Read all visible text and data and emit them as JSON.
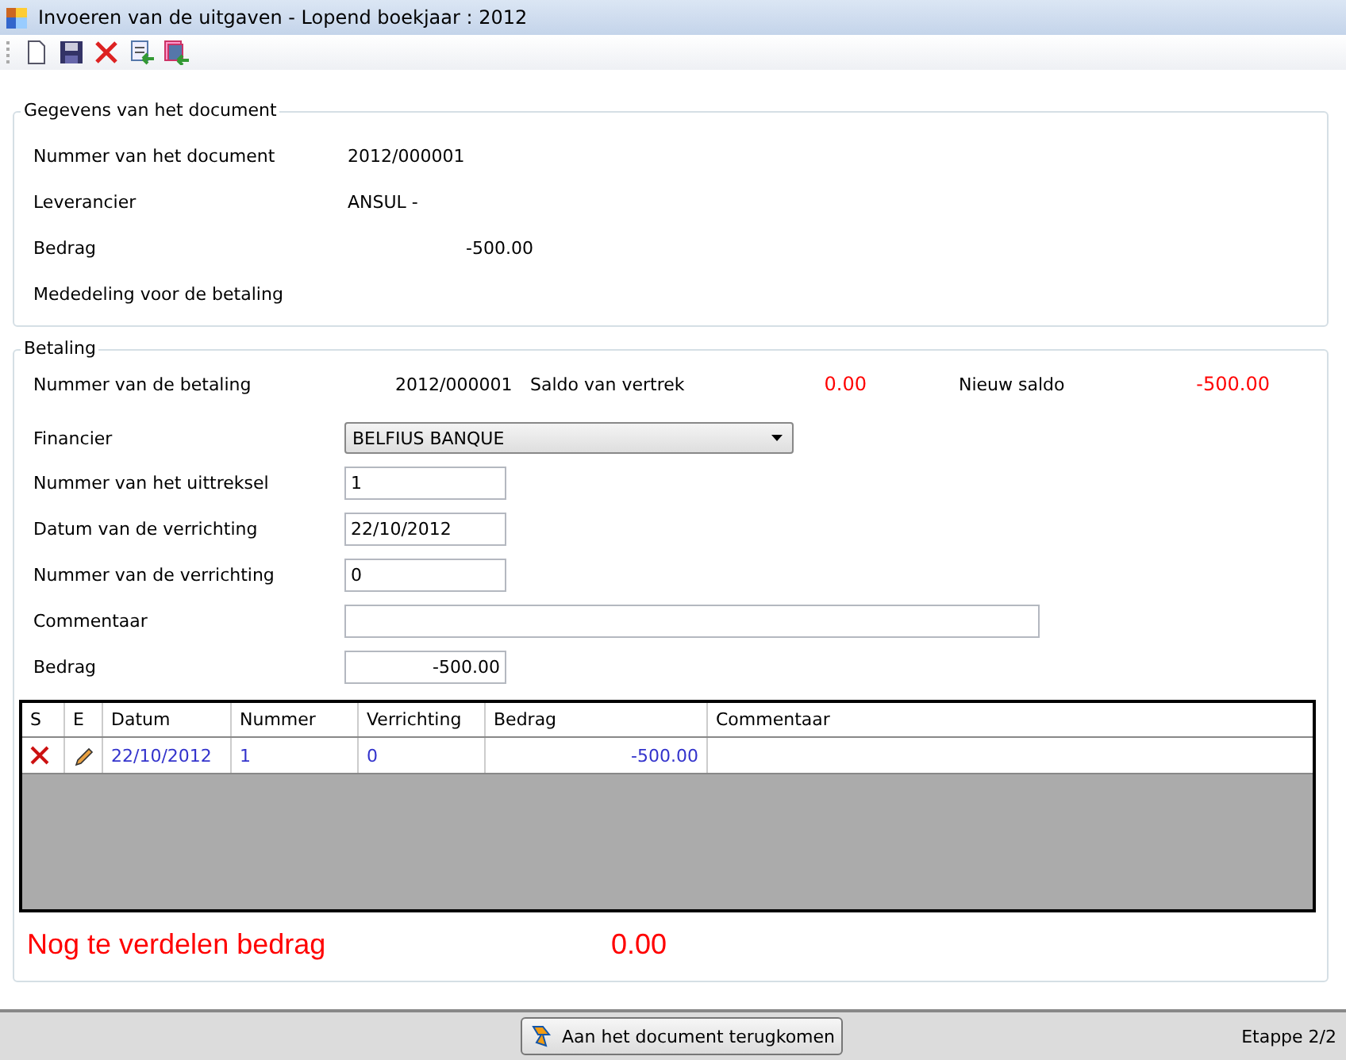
{
  "window": {
    "title": "Invoeren van de uitgaven - Lopend boekjaar : 2012"
  },
  "toolbar": {
    "buttons": [
      {
        "kind": "new"
      },
      {
        "kind": "save"
      },
      {
        "kind": "delete"
      },
      {
        "kind": "import"
      },
      {
        "kind": "export"
      }
    ]
  },
  "document": {
    "title": "Gegevens van het document",
    "fields": [
      {
        "label": "Nummer van het document",
        "value": "2012/000001",
        "kind": "text"
      },
      {
        "label": "Leverancier",
        "value": "ANSUL -",
        "kind": "text"
      },
      {
        "label": "Bedrag",
        "value": "-500.00",
        "kind": "amount"
      },
      {
        "label": "Mededeling voor de betaling"
      }
    ]
  },
  "payment": {
    "title": "Betaling",
    "summary": {
      "label": "Nummer van de betaling",
      "number": "2012/000001",
      "start_label": "Saldo  van vertrek",
      "start_value": "0.00",
      "new_label": "Nieuw  saldo",
      "new_value": "-500.00"
    },
    "fields": [
      {
        "label": "Financier",
        "value": "BELFIUS BANQUE",
        "kind": "combo"
      },
      {
        "label": "Nummer van het uittreksel",
        "value": "1",
        "kind": "input"
      },
      {
        "label": "Datum van de verrichting",
        "value": "22/10/2012",
        "kind": "input"
      },
      {
        "label": "Nummer van de verrichting",
        "value": "0",
        "kind": "input"
      },
      {
        "label": "Commentaar",
        "kind": "wide"
      },
      {
        "label": "Bedrag",
        "value": "-500.00",
        "kind": "amount"
      }
    ],
    "table": {
      "columns": [
        "S",
        "E",
        "Datum",
        "Nummer",
        "Verrichting",
        "Bedrag",
        "Commentaar"
      ],
      "rows": [
        {
          "datum": "22/10/2012",
          "nummer": "1",
          "verrichting": "0",
          "bedrag": "-500.00"
        }
      ]
    },
    "remaining": {
      "label": "Nog te verdelen bedrag",
      "value": "0.00"
    }
  },
  "footer": {
    "button": "Aan het document terugkomen",
    "step": "Etappe 2/2"
  }
}
